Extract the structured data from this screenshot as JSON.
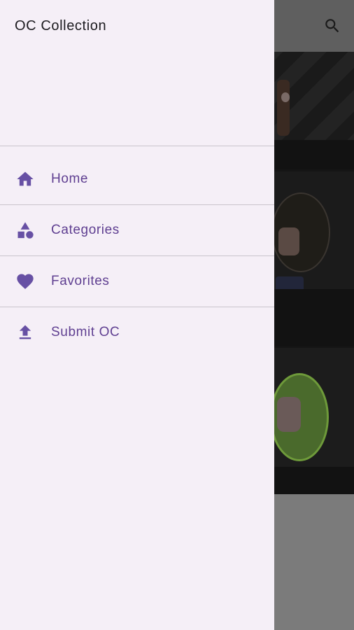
{
  "drawer": {
    "title": "OC Collection",
    "items": [
      {
        "label": "Home",
        "icon": "home-icon"
      },
      {
        "label": "Categories",
        "icon": "categories-icon"
      },
      {
        "label": "Favorites",
        "icon": "heart-icon"
      },
      {
        "label": "Submit OC",
        "icon": "upload-icon"
      }
    ]
  },
  "appbar": {
    "search_icon": "search-icon"
  },
  "colors": {
    "drawer_bg": "#f5eff7",
    "accent": "#6750a4",
    "label": "#5f3f91",
    "scrim": "rgba(0,0,0,0.55)"
  }
}
